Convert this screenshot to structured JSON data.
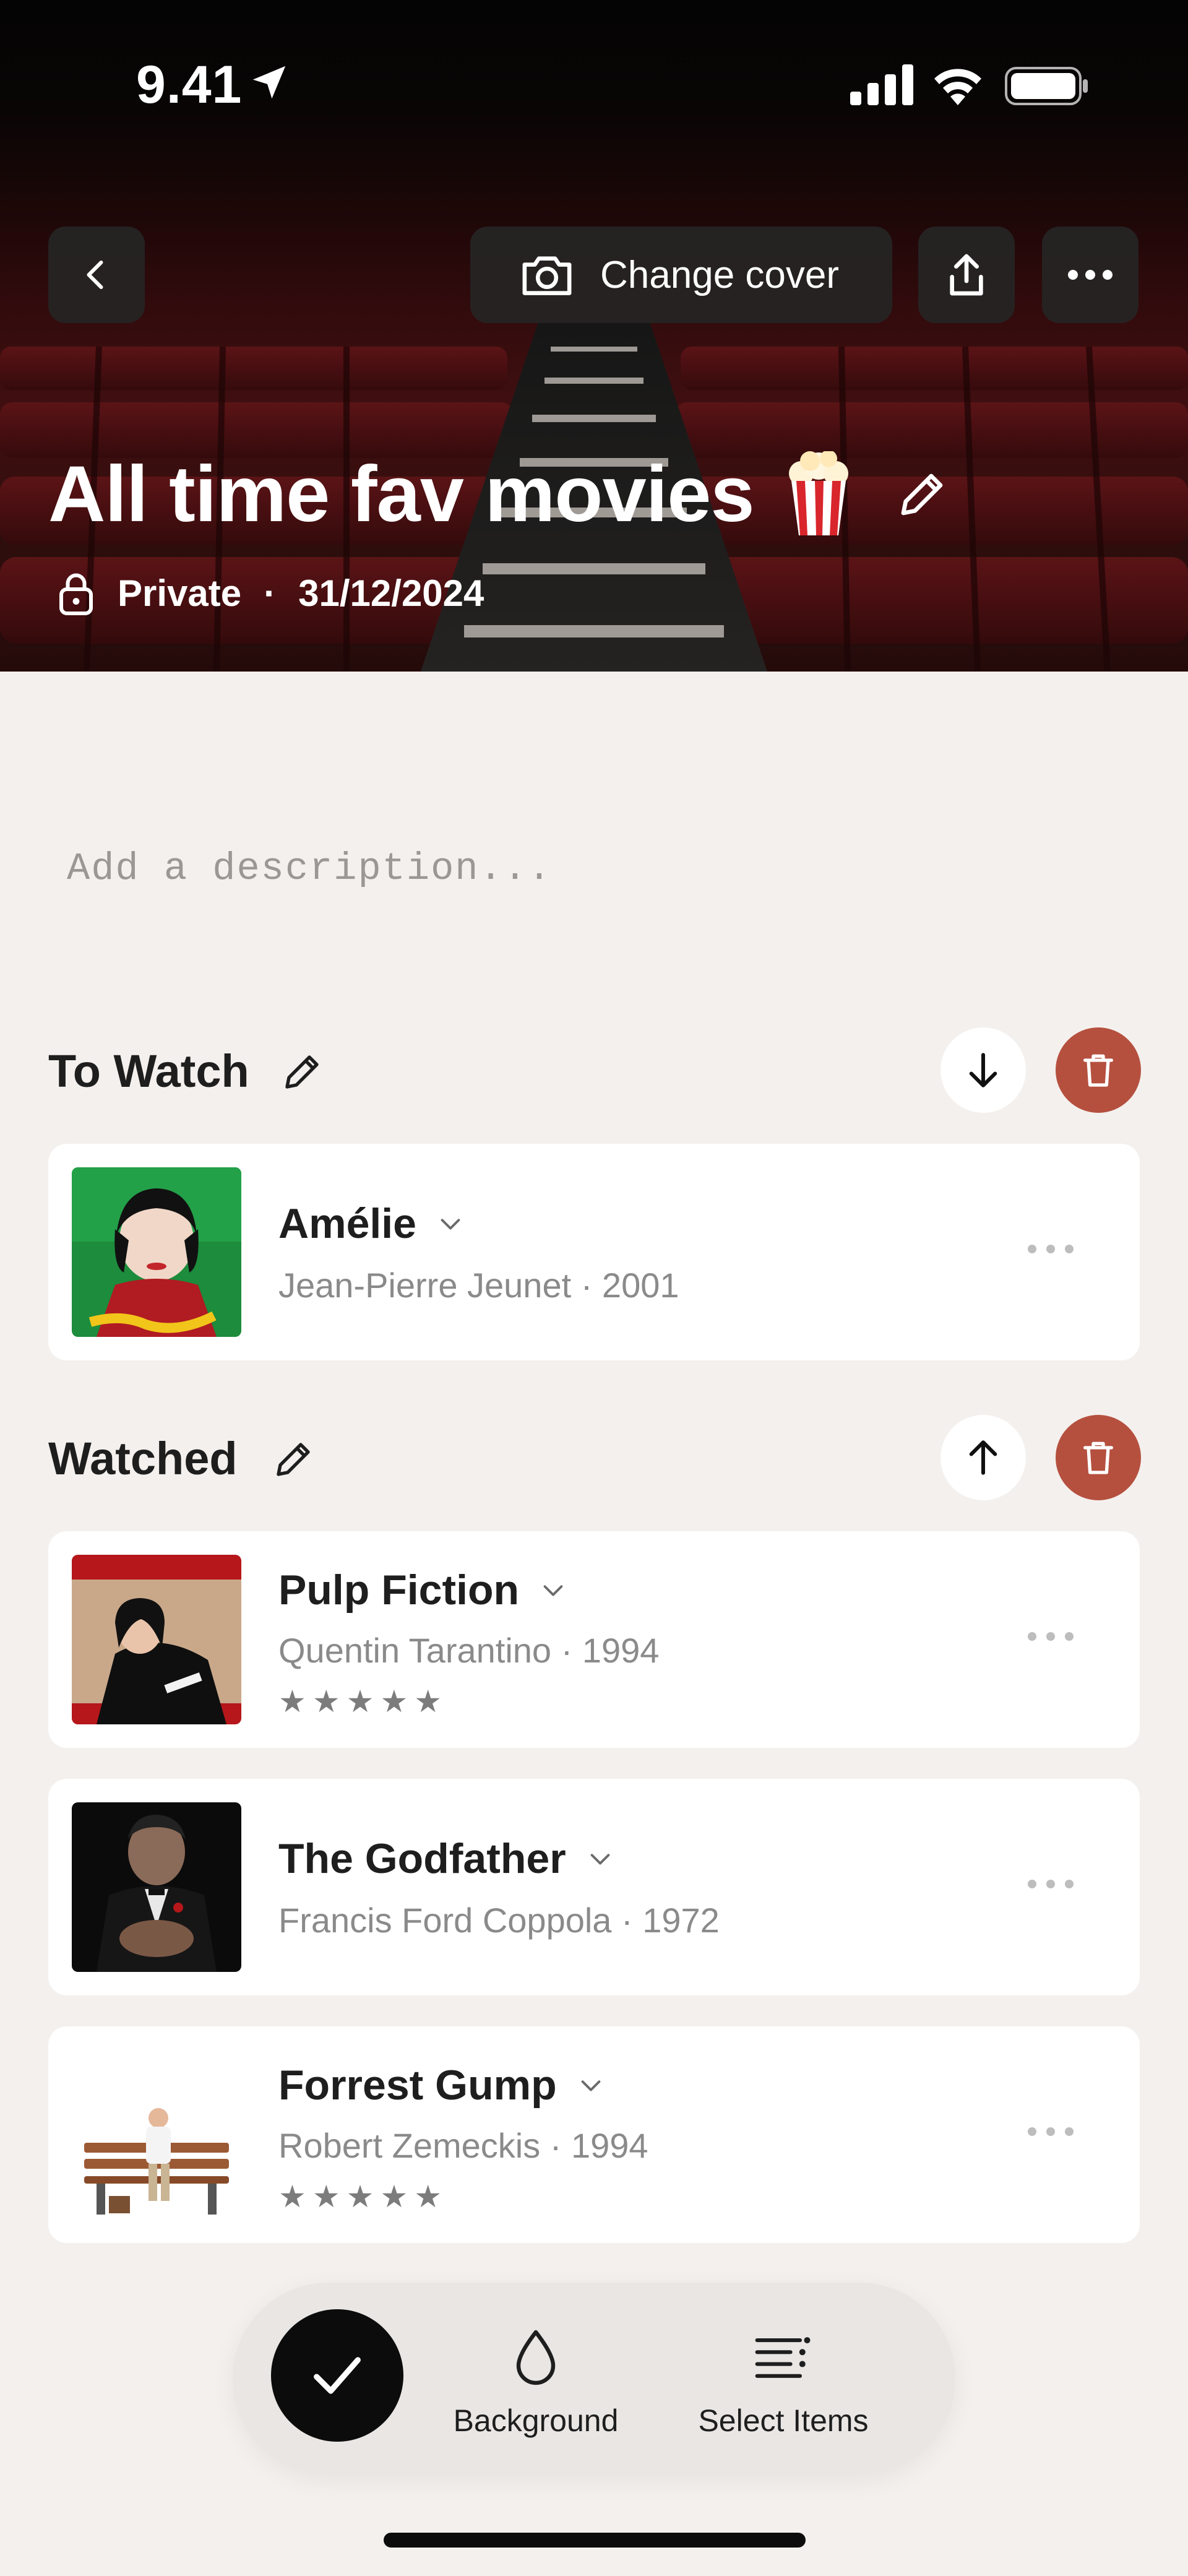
{
  "status_bar": {
    "time": "9.41"
  },
  "header": {
    "change_cover_label": "Change cover",
    "title": "All time fav movies",
    "title_emoji": "popcorn-icon",
    "privacy": "Private",
    "separator": "·",
    "date": "31/12/2024"
  },
  "description": {
    "placeholder": "Add a description..."
  },
  "sections": [
    {
      "title": "To Watch",
      "items": [
        {
          "title": "Amélie",
          "subtitle": "Jean-Pierre Jeunet · 2001",
          "stars": ""
        }
      ]
    },
    {
      "title": "Watched",
      "items": [
        {
          "title": "Pulp Fiction",
          "subtitle": "Quentin Tarantino · 1994",
          "stars": "★★★★★"
        },
        {
          "title": "The Godfather",
          "subtitle": "Francis Ford Coppola · 1972",
          "stars": ""
        },
        {
          "title": "Forrest Gump",
          "subtitle": "Robert Zemeckis · 1994",
          "stars": "★★★★★"
        }
      ]
    }
  ],
  "bottom_bar": {
    "background_label": "Background",
    "select_items_label": "Select Items"
  },
  "colors": {
    "accent_red": "#b5503f",
    "page_bg": "#f4f0ed",
    "card_bg": "#ffffff",
    "muted_text": "#8a8a8a"
  }
}
